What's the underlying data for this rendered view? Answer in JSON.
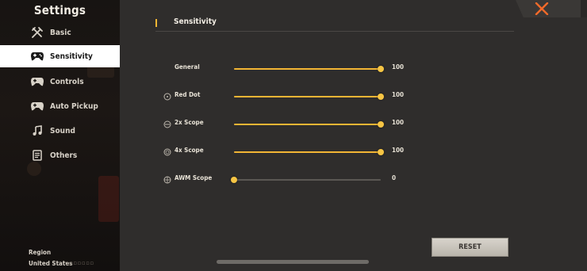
{
  "sidebar": {
    "title": "Settings",
    "items": [
      {
        "label": "Basic",
        "icon": "tools-icon"
      },
      {
        "label": "Sensitivity",
        "icon": "gamepad-icon",
        "active": true
      },
      {
        "label": "Controls",
        "icon": "gamepad-icon"
      },
      {
        "label": "Auto Pickup",
        "icon": "gamepad-icon"
      },
      {
        "label": "Sound",
        "icon": "music-note-icon"
      },
      {
        "label": "Others",
        "icon": "document-icon"
      }
    ],
    "region_label": "Region",
    "region_value": "United States"
  },
  "main": {
    "section_title": "Sensitivity",
    "sliders": [
      {
        "label": "General",
        "value": 100,
        "max": 100,
        "icon": ""
      },
      {
        "label": "Red Dot",
        "value": 100,
        "max": 100,
        "icon": "red-dot-scope-icon"
      },
      {
        "label": "2x Scope",
        "value": 100,
        "max": 100,
        "icon": "2x-scope-icon"
      },
      {
        "label": "4x Scope",
        "value": 100,
        "max": 100,
        "icon": "4x-scope-icon"
      },
      {
        "label": "AWM Scope",
        "value": 0,
        "max": 100,
        "icon": "awm-scope-icon"
      }
    ],
    "reset_label": "RESET"
  },
  "colors": {
    "accent": "#f2b534",
    "sidebar_bg": "#171412",
    "panel_bg": "#2f2d2c",
    "active_item_bg": "#ffffff",
    "close_x": "#f26a2a"
  }
}
